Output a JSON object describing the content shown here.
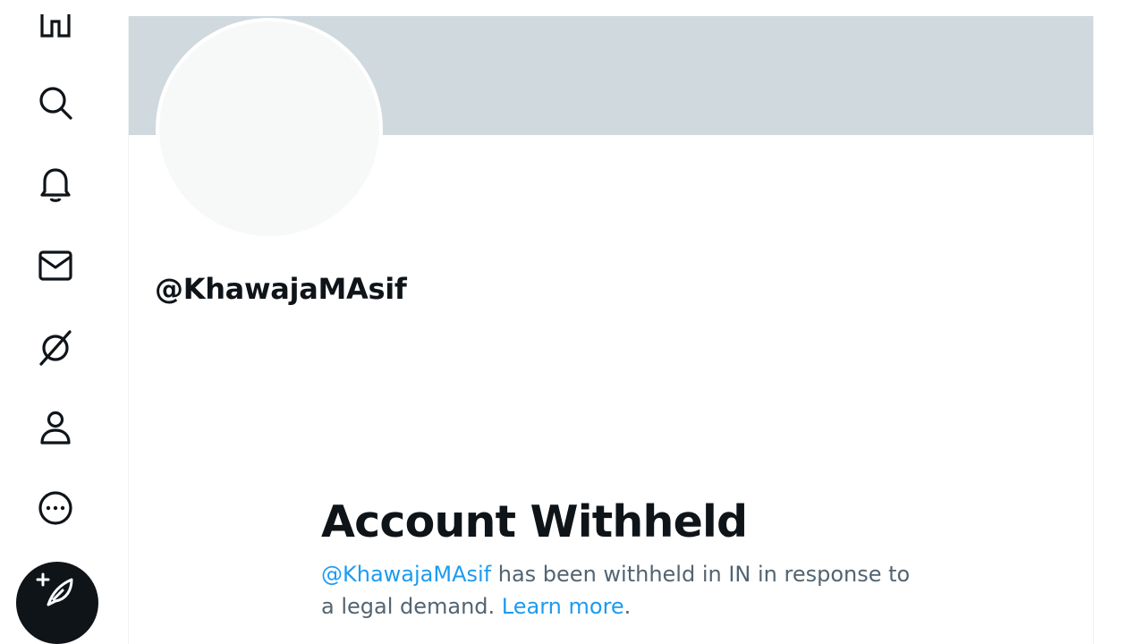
{
  "nav": {
    "items": [
      {
        "name": "home",
        "icon": "home-icon"
      },
      {
        "name": "explore",
        "icon": "search-icon"
      },
      {
        "name": "notifications",
        "icon": "bell-icon"
      },
      {
        "name": "messages",
        "icon": "envelope-icon"
      },
      {
        "name": "grok",
        "icon": "slash-circle-icon"
      },
      {
        "name": "profile",
        "icon": "person-icon"
      },
      {
        "name": "more",
        "icon": "more-circle-icon"
      }
    ],
    "post_button_icon": "feather-plus-icon"
  },
  "profile": {
    "handle": "@KhawajaMAsif",
    "banner_color": "#cfd9de",
    "avatar_color": "#f7f9f9"
  },
  "withheld": {
    "title": "Account Withheld",
    "handle_link": "@KhawajaMAsif",
    "message": " has been withheld in IN in response to a legal demand. ",
    "learn_more": "Learn more",
    "period": "."
  },
  "colors": {
    "accent": "#1d9bf0",
    "text_primary": "#0f1419",
    "text_secondary": "#536471"
  }
}
